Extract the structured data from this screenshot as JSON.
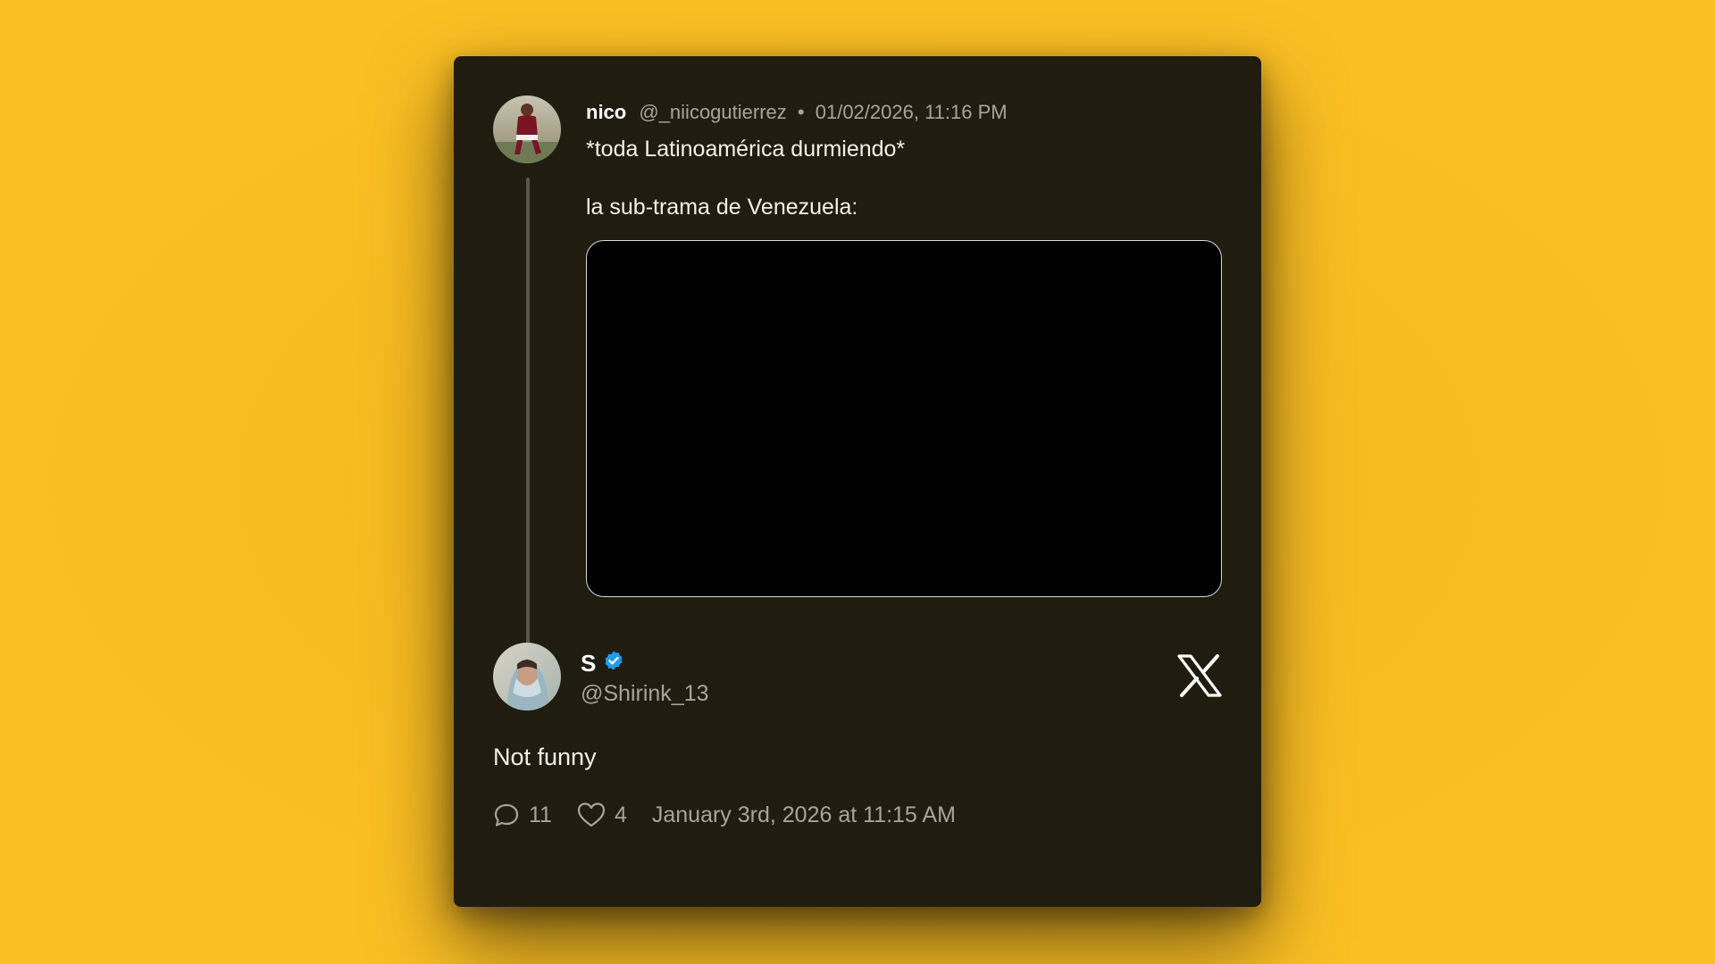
{
  "quoted_tweet": {
    "display_name": "nico",
    "handle": "@_niicogutierrez",
    "separator": "•",
    "timestamp": "01/02/2026, 11:16 PM",
    "text_line_1": "*toda Latinoamérica durmiendo*",
    "text_line_2": "la sub-trama de Venezuela:"
  },
  "tweet": {
    "display_name": "S",
    "handle": "@Shirink_13",
    "verified": true,
    "text": "Not funny",
    "replies": "11",
    "likes": "4",
    "date": "January 3rd, 2026 at 11:15 AM"
  },
  "icons": {
    "platform": "x-logo-icon",
    "verified": "verified-badge-icon",
    "reply": "reply-icon",
    "like": "heart-icon"
  },
  "colors": {
    "page_background": "#fbbf24",
    "card_background": "#211c10",
    "verified_blue": "#1d9bf0",
    "muted_text": "#a8a498"
  }
}
